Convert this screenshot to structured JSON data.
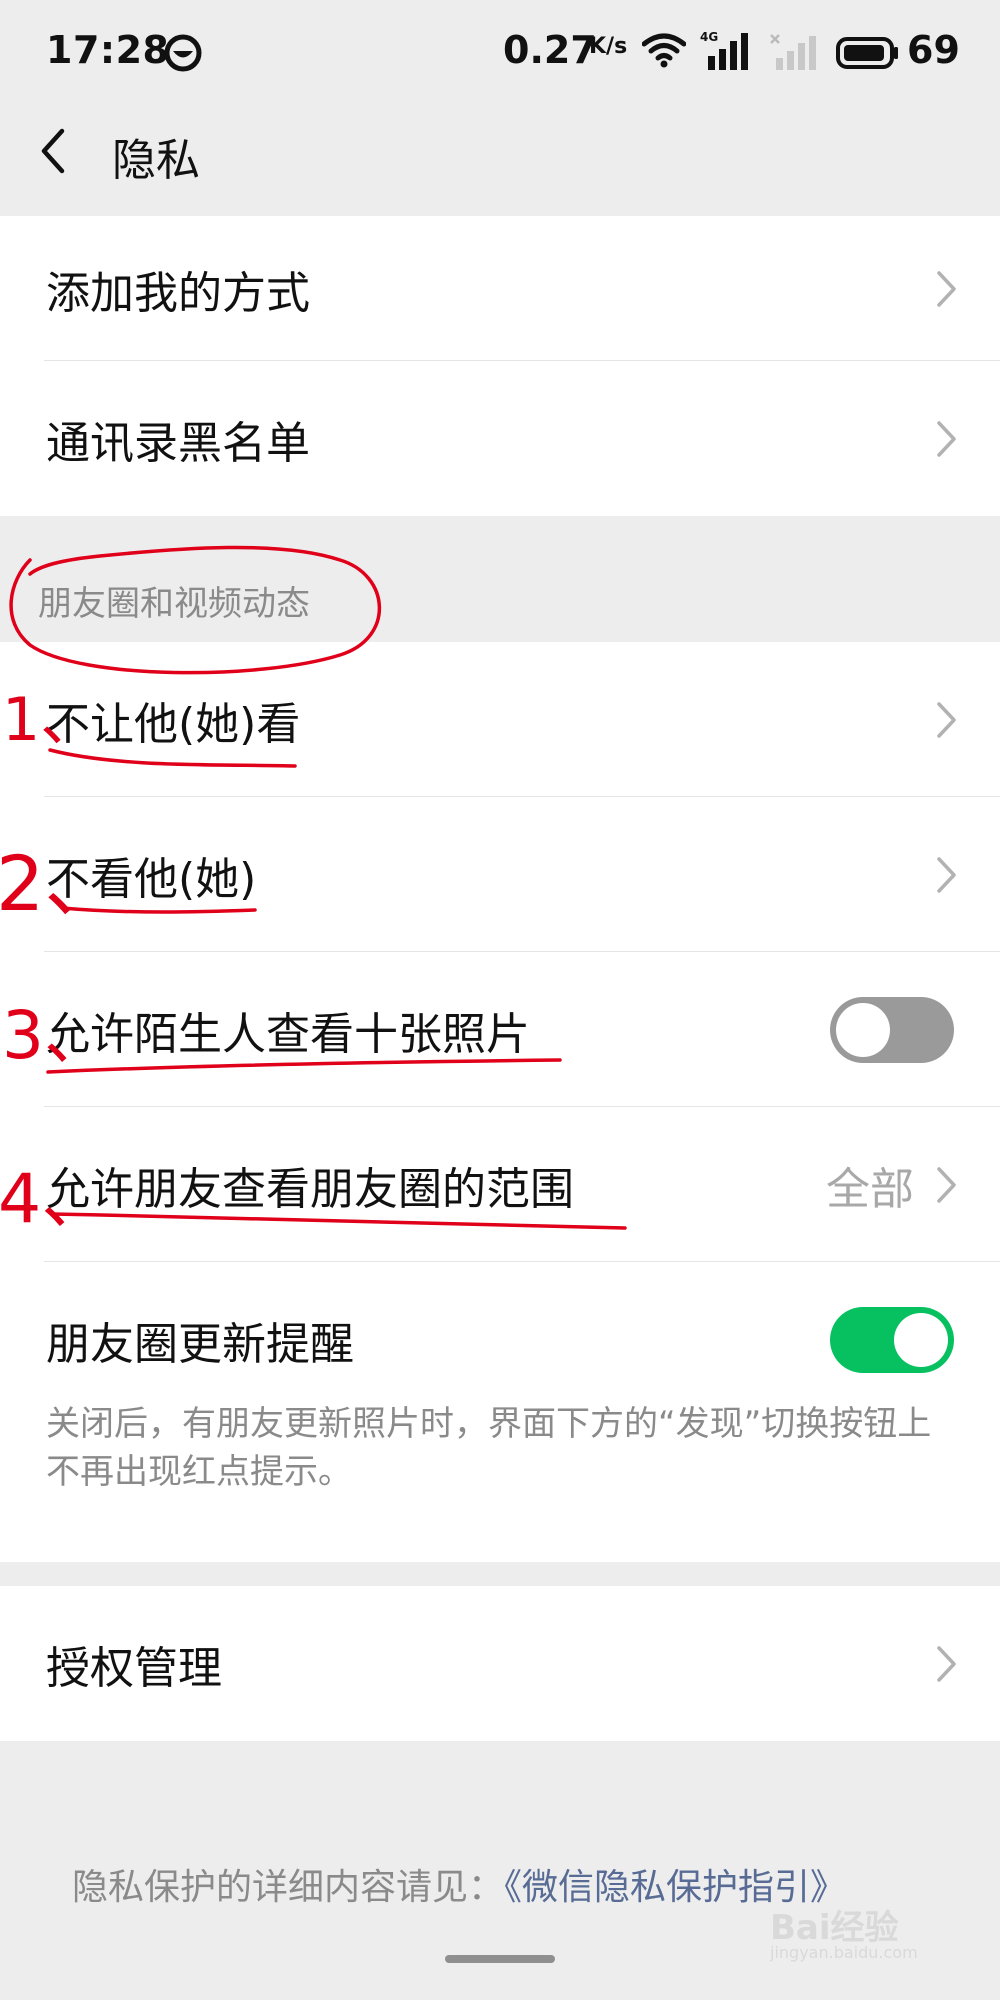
{
  "status_bar": {
    "time": "17:28",
    "speed": "0.27",
    "speed_unit": "K/s",
    "network_label": "4G",
    "battery": "69"
  },
  "nav": {
    "title": "隐私"
  },
  "groups": {
    "top": [
      {
        "label": "添加我的方式"
      },
      {
        "label": "通讯录黑名单"
      }
    ],
    "moments_header": "朋友圈和视频动态",
    "moments": [
      {
        "label": "不让他(她)看"
      },
      {
        "label": "不看他(她)"
      },
      {
        "label": "允许陌生人查看十张照片",
        "toggle": "off"
      },
      {
        "label": "允许朋友查看朋友圈的范围",
        "value": "全部"
      },
      {
        "label": "朋友圈更新提醒",
        "toggle": "on"
      }
    ],
    "moments_desc": "关闭后，有朋友更新照片时，界面下方的“发现”切换按钮上不再出现红点提示。",
    "auth": [
      {
        "label": "授权管理"
      }
    ]
  },
  "annotations": [
    "1、",
    "2、",
    "3、",
    "4、"
  ],
  "footer": {
    "text": "隐私保护的详细内容请见：",
    "link": "《微信隐私保护指引》"
  },
  "watermark": {
    "text": "Bai经验",
    "sub": "jingyan.baidu.com"
  },
  "colors": {
    "background": "#ededed",
    "toggle_on": "#07c160",
    "toggle_off": "#9a9a9a",
    "link": "#576b95",
    "annotation_red": "#e0001a"
  }
}
